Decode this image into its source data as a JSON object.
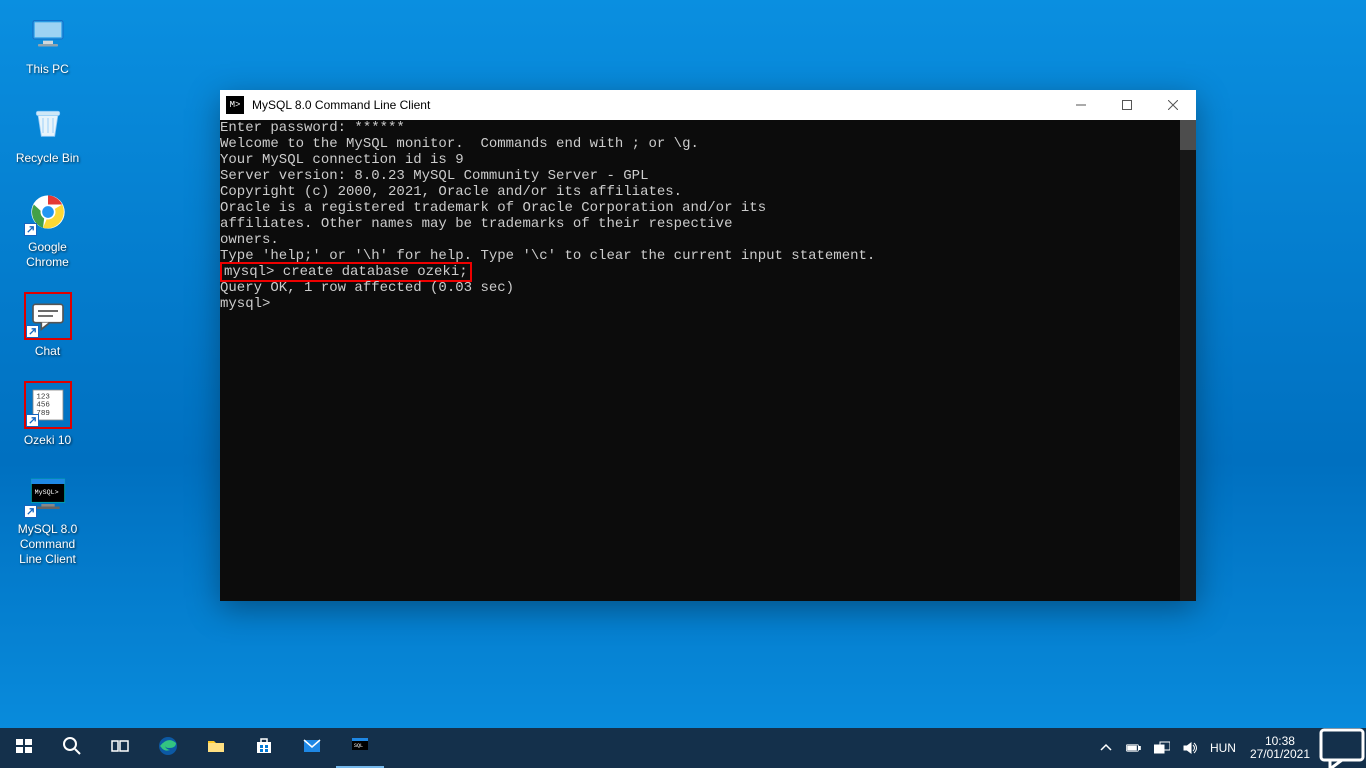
{
  "desktop_icons": [
    {
      "name": "this-pc",
      "label": "This PC",
      "shortcut": false,
      "red_border": false,
      "icon": "pc"
    },
    {
      "name": "recycle-bin",
      "label": "Recycle Bin",
      "shortcut": false,
      "red_border": false,
      "icon": "bin"
    },
    {
      "name": "google-chrome",
      "label": "Google Chrome",
      "shortcut": true,
      "red_border": false,
      "icon": "chrome"
    },
    {
      "name": "chat",
      "label": "Chat",
      "shortcut": true,
      "red_border": true,
      "icon": "chat"
    },
    {
      "name": "ozeki-10",
      "label": "Ozeki 10",
      "shortcut": true,
      "red_border": true,
      "icon": "ozeki"
    },
    {
      "name": "mysql-client",
      "label": "MySQL 8.0 Command Line Client",
      "shortcut": true,
      "red_border": false,
      "icon": "mysql"
    }
  ],
  "window": {
    "title": "MySQL 8.0 Command Line Client",
    "icon_glyph": "M>",
    "terminal_lines": [
      "Enter password: ******",
      "Welcome to the MySQL monitor.  Commands end with ; or \\g.",
      "Your MySQL connection id is 9",
      "Server version: 8.0.23 MySQL Community Server - GPL",
      "",
      "Copyright (c) 2000, 2021, Oracle and/or its affiliates.",
      "",
      "Oracle is a registered trademark of Oracle Corporation and/or its",
      "affiliates. Other names may be trademarks of their respective",
      "owners.",
      "",
      "Type 'help;' or '\\h' for help. Type '\\c' to clear the current input statement.",
      ""
    ],
    "highlighted_command": "mysql> create database ozeki;",
    "after_highlight_lines": [
      "Query OK, 1 row affected (0.03 sec)",
      "",
      "mysql>"
    ]
  },
  "taskbar": {
    "items": [
      {
        "name": "start",
        "icon": "windows"
      },
      {
        "name": "search",
        "icon": "search"
      },
      {
        "name": "task-view",
        "icon": "taskview"
      },
      {
        "name": "edge",
        "icon": "edge"
      },
      {
        "name": "file-explorer",
        "icon": "folder"
      },
      {
        "name": "ms-store",
        "icon": "store"
      },
      {
        "name": "mail",
        "icon": "mail"
      },
      {
        "name": "mysql-running",
        "icon": "mysql",
        "running": true
      }
    ],
    "tray": {
      "language": "HUN",
      "time": "10:38",
      "date": "27/01/2021"
    }
  }
}
